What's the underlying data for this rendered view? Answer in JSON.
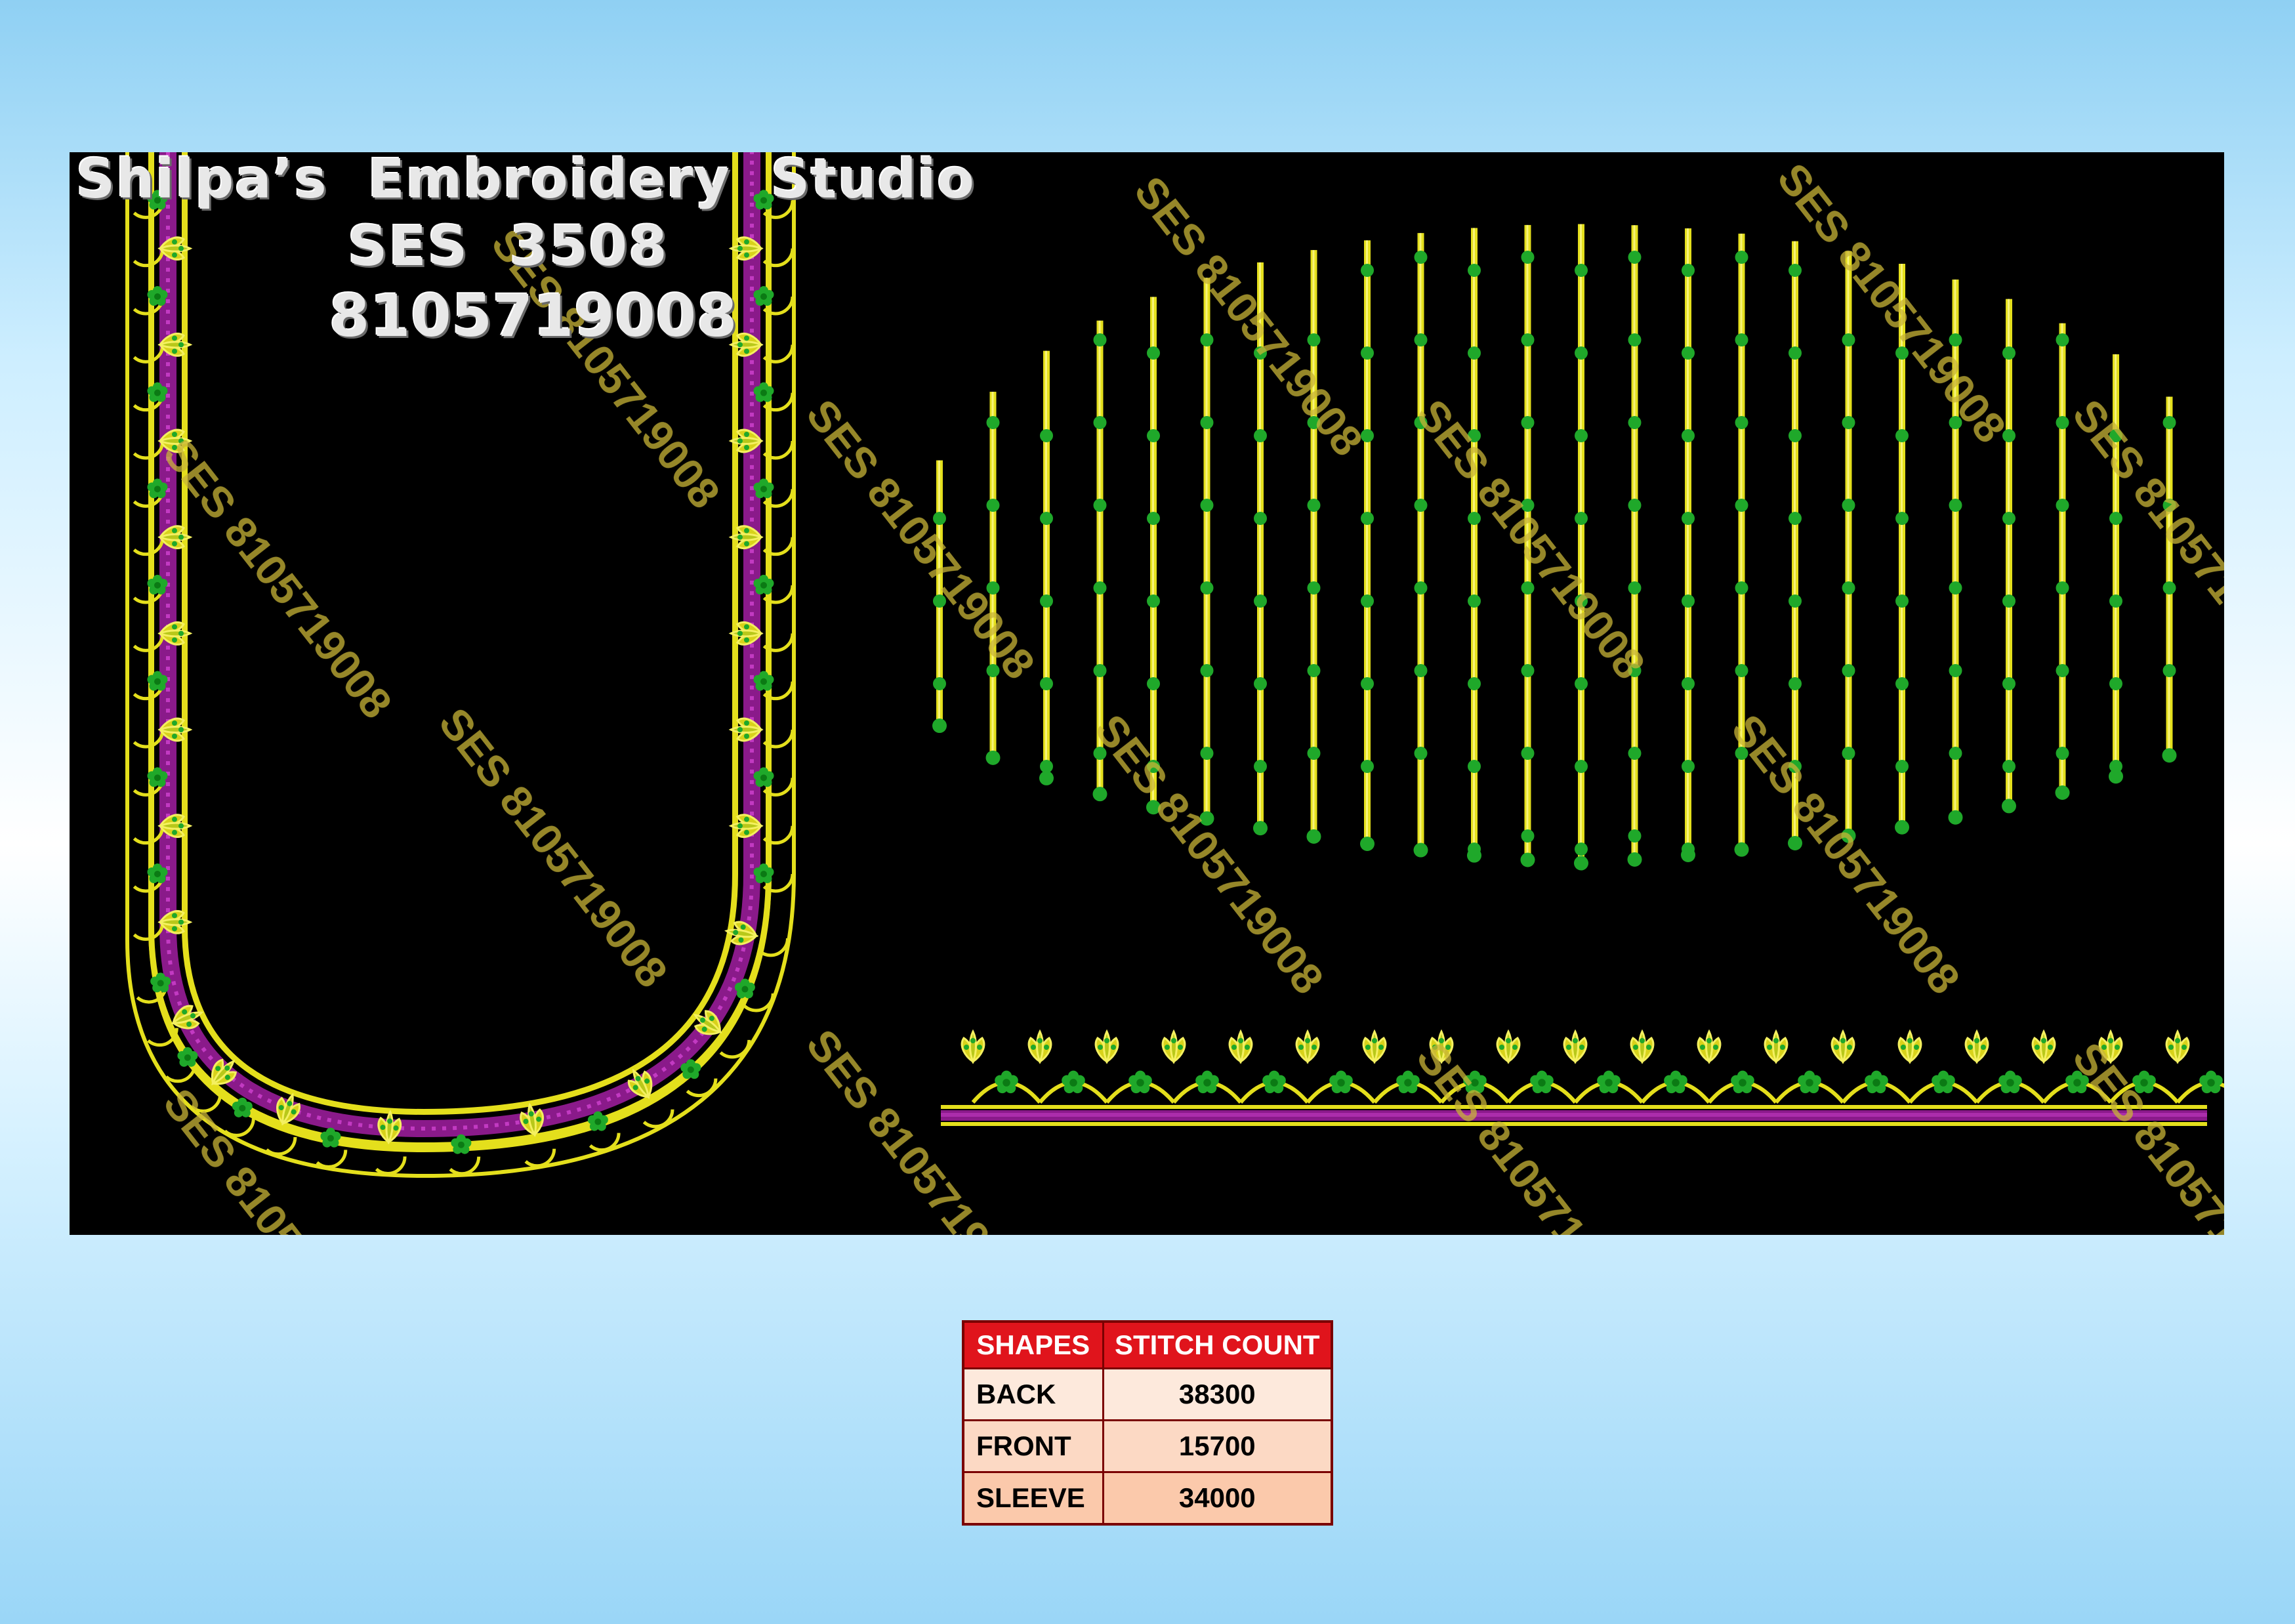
{
  "header": {
    "studio_name": "Shilpa’s  Embroidery  Studio",
    "design_code": "SES  3508",
    "phone": "8105719008"
  },
  "watermark": {
    "text": "SES 8105719008"
  },
  "table": {
    "headers": [
      "SHAPES",
      "STITCH COUNT"
    ],
    "rows": [
      {
        "shape": "BACK",
        "count": "38300"
      },
      {
        "shape": "FRONT",
        "count": "15700"
      },
      {
        "shape": "SLEEVE",
        "count": "34000"
      }
    ]
  },
  "colors": {
    "canvas": "#000000",
    "gold_thread": "#e4df1c",
    "purple_thread": "#8a1a8a",
    "green_bead": "#1fa82a",
    "watermark": "#c8b437",
    "table_header": "#e0141c"
  },
  "icons": [
    "blouse-neck-motif-icon",
    "sleeve-stripes-motif-icon",
    "border-lace-motif-icon"
  ]
}
